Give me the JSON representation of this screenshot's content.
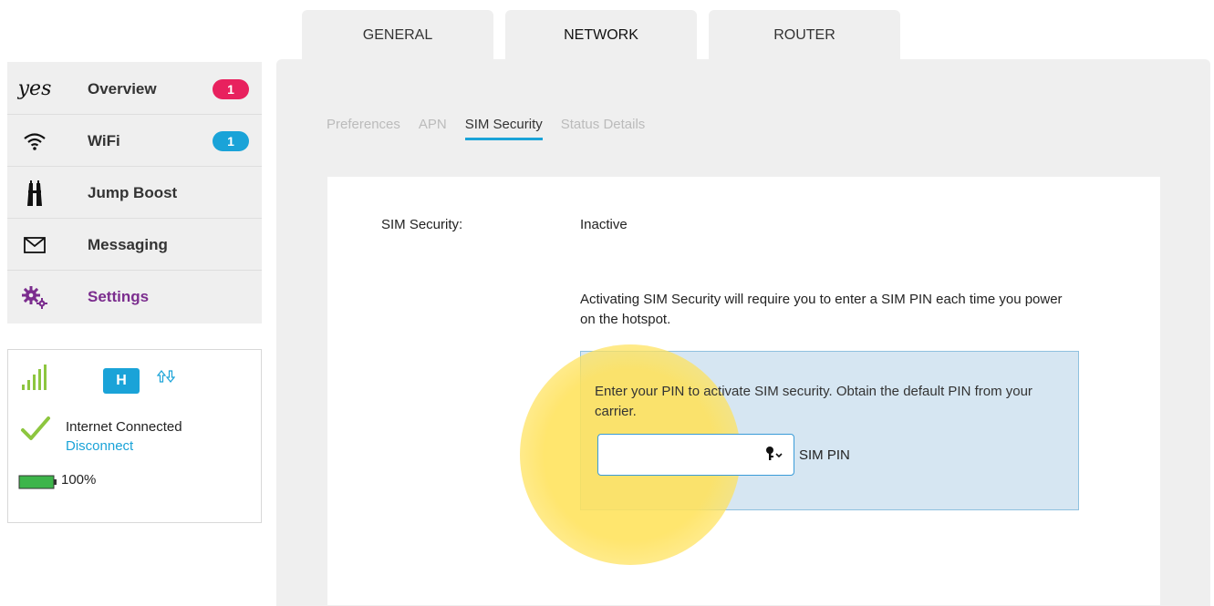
{
  "top_tabs": [
    {
      "label": "GENERAL"
    },
    {
      "label": "NETWORK"
    },
    {
      "label": "ROUTER"
    }
  ],
  "active_top_tab": "NETWORK",
  "sidebar": {
    "logo_text": "yes",
    "items": [
      {
        "label": "Overview",
        "icon": "yes-logo-icon",
        "badge": "1",
        "badge_color": "#e8215e"
      },
      {
        "label": "WiFi",
        "icon": "wifi-icon",
        "badge": "1",
        "badge_color": "#1aa3d8"
      },
      {
        "label": "Jump Boost",
        "icon": "jump-boost-icon"
      },
      {
        "label": "Messaging",
        "icon": "envelope-icon"
      },
      {
        "label": "Settings",
        "icon": "gears-icon",
        "active": true,
        "color": "#7b2d8e"
      }
    ]
  },
  "status": {
    "network_type": "H",
    "connection": "Internet Connected",
    "disconnect_label": "Disconnect",
    "battery": "100%"
  },
  "sub_tabs": [
    {
      "label": "Preferences"
    },
    {
      "label": "APN"
    },
    {
      "label": "SIM Security",
      "active": true
    },
    {
      "label": "Status Details"
    }
  ],
  "content": {
    "sim_security_label": "SIM Security:",
    "sim_security_value": "Inactive",
    "description": "Activating SIM Security will require you to enter a SIM PIN each time you power on the hotspot.",
    "pin_instructions": "Enter your PIN to activate SIM security. Obtain the default PIN from your carrier.",
    "pin_field_label": "SIM PIN"
  },
  "colors": {
    "accent_blue": "#1aa3d8",
    "badge_red": "#e8215e",
    "settings_purple": "#7b2d8e",
    "highlight_yellow": "#ffe25a"
  }
}
